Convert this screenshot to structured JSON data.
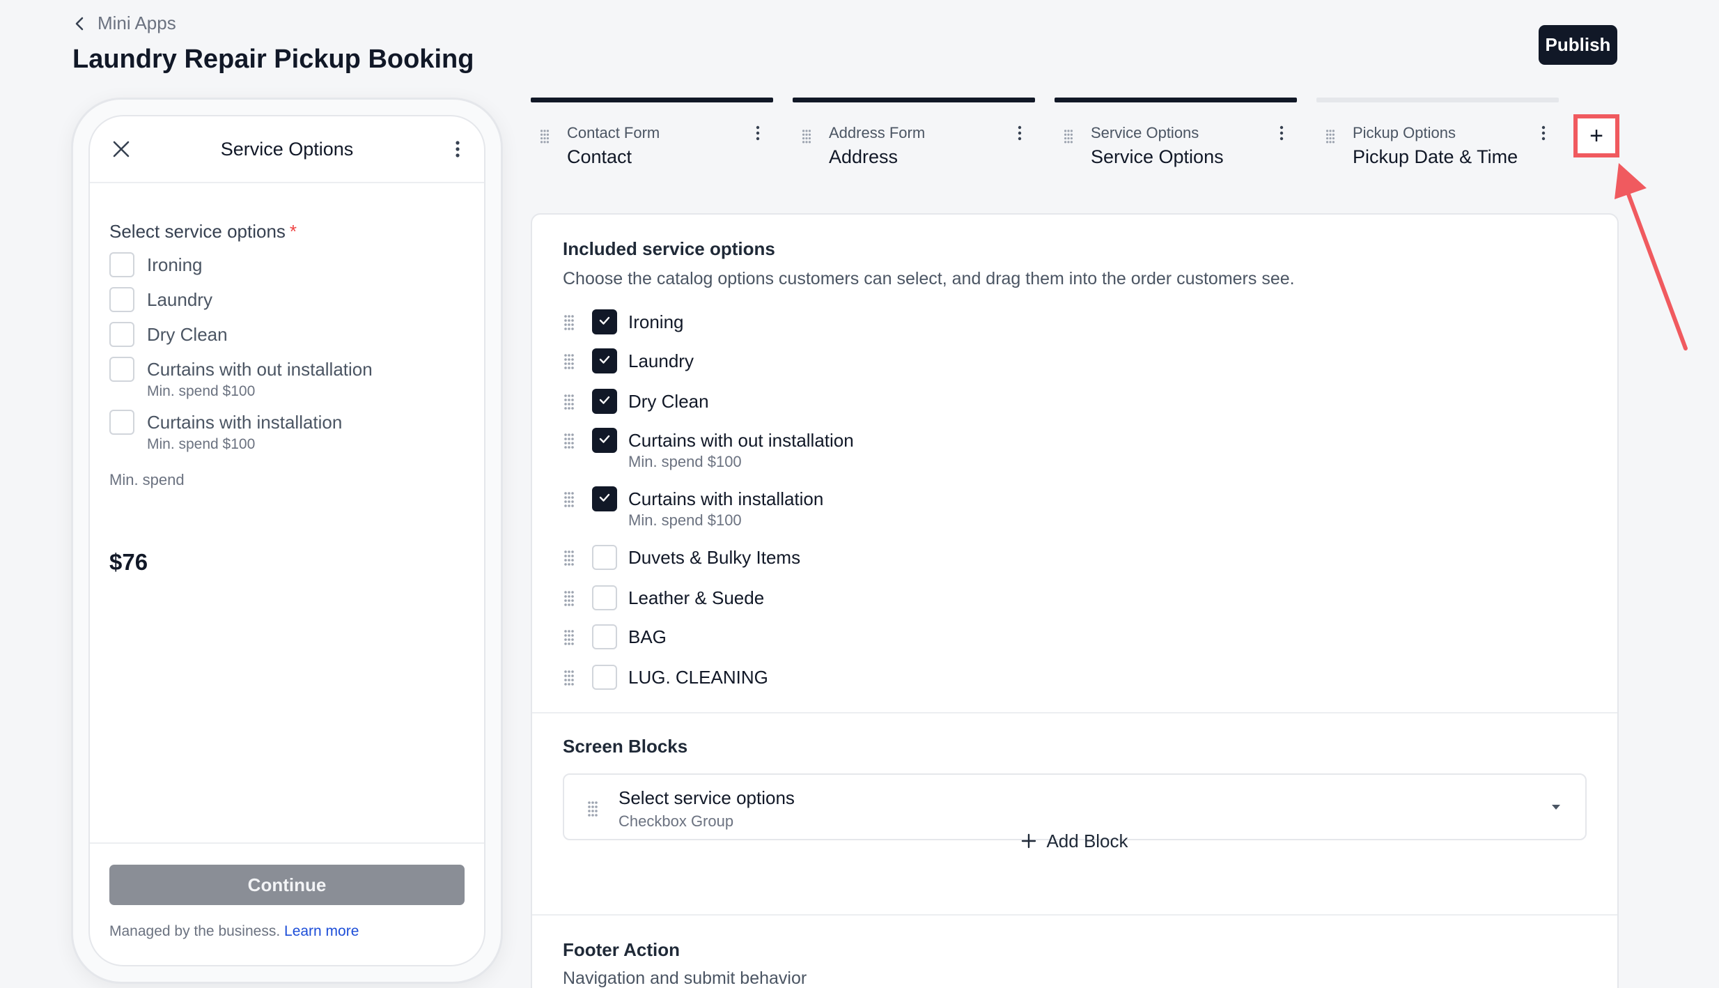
{
  "header": {
    "back_label": "Mini Apps",
    "page_title": "Laundry Repair Pickup Booking",
    "publish_label": "Publish"
  },
  "preview": {
    "title": "Service Options",
    "question": "Select service options",
    "required_mark": "*",
    "options": [
      {
        "label": "Ironing",
        "sub": ""
      },
      {
        "label": "Laundry",
        "sub": ""
      },
      {
        "label": "Dry Clean",
        "sub": ""
      },
      {
        "label": "Curtains with out installation",
        "sub": "Min. spend $100"
      },
      {
        "label": "Curtains with installation",
        "sub": "Min. spend $100"
      }
    ],
    "min_spend_label": "Min. spend",
    "amount": "$76",
    "continue_label": "Continue",
    "managed_text": "Managed by the business.",
    "learn_more": "Learn more"
  },
  "steps": [
    {
      "kind": "Contact Form",
      "name": "Contact",
      "active": true
    },
    {
      "kind": "Address Form",
      "name": "Address",
      "active": true
    },
    {
      "kind": "Service Options",
      "name": "Service Options",
      "active": true
    },
    {
      "kind": "Pickup Options",
      "name": "Pickup Date & Time",
      "active": false
    }
  ],
  "add_step_icon": "plus-icon",
  "included": {
    "title": "Included service options",
    "description": "Choose the catalog options customers can select, and drag them into the order customers see.",
    "options": [
      {
        "label": "Ironing",
        "sub": "",
        "checked": true
      },
      {
        "label": "Laundry",
        "sub": "",
        "checked": true
      },
      {
        "label": "Dry Clean",
        "sub": "",
        "checked": true
      },
      {
        "label": "Curtains with out installation",
        "sub": "Min. spend $100",
        "checked": true
      },
      {
        "label": "Curtains with installation",
        "sub": "Min. spend $100",
        "checked": true
      },
      {
        "label": "Duvets & Bulky Items",
        "sub": "",
        "checked": false
      },
      {
        "label": "Leather & Suede",
        "sub": "",
        "checked": false
      },
      {
        "label": "BAG",
        "sub": "",
        "checked": false
      },
      {
        "label": "LUG. CLEANING",
        "sub": "",
        "checked": false
      }
    ]
  },
  "screen_blocks": {
    "title": "Screen Blocks",
    "block_name": "Select service options",
    "block_type": "Checkbox Group",
    "add_block_label": "Add Block"
  },
  "footer_action": {
    "title": "Footer Action",
    "description": "Navigation and submit behavior"
  },
  "colors": {
    "accent_dark": "#111827",
    "highlight_red": "#f05a5f",
    "link_blue": "#1d4ed8"
  }
}
